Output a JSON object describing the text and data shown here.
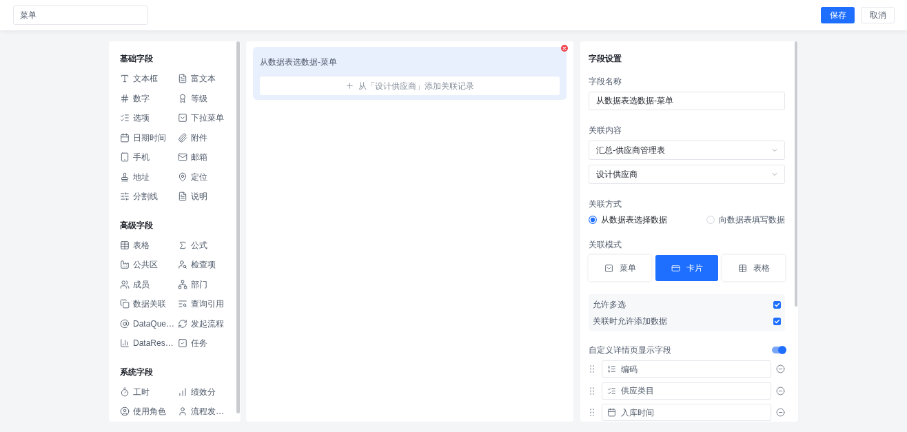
{
  "header": {
    "title_input": {
      "value": "菜单"
    },
    "buttons": [
      {
        "label": "保存",
        "kind": "primary"
      },
      {
        "label": "取消",
        "kind": "secondary"
      }
    ]
  },
  "field_palette": {
    "sections": [
      {
        "title": "基础字段",
        "items": [
          "文本框",
          "富文本",
          "数字",
          "等级",
          "选项",
          "下拉菜单",
          "日期时间",
          "附件",
          "手机",
          "邮箱",
          "地址",
          "定位",
          "分割线",
          "说明"
        ]
      },
      {
        "title": "高级字段",
        "items": [
          "表格",
          "公式",
          "公共区",
          "检查项",
          "成员",
          "部门",
          "数据关联",
          "查询引用",
          "DataQue…",
          "发起流程",
          "DataRes…",
          "任务"
        ]
      },
      {
        "title": "系统字段",
        "items": [
          "工时",
          "绩效分",
          "使用角色",
          "流程发…"
        ]
      }
    ]
  },
  "canvas": {
    "fields": [
      {
        "label": "从数据表选数据-菜单",
        "selected": true,
        "add_button": "从「设计供应商」添加关联记录"
      }
    ]
  },
  "settings": {
    "title": "字段设置",
    "field_name": {
      "label": "字段名称",
      "value": "从数据表选数据-菜单"
    },
    "related_content": {
      "label": "关联内容",
      "selects": [
        {
          "value": "汇总-供应商管理表"
        },
        {
          "value": "设计供应商"
        }
      ]
    },
    "relation_method": {
      "label": "关联方式",
      "options": [
        {
          "label": "从数据表选择数据",
          "selected": true
        },
        {
          "label": "向数据表填写数据",
          "selected": false
        }
      ]
    },
    "relation_mode": {
      "label": "关联模式",
      "options": [
        {
          "label": "菜单",
          "selected": false
        },
        {
          "label": "卡片",
          "selected": true
        },
        {
          "label": "表格",
          "selected": false
        }
      ]
    },
    "options": [
      {
        "label": "允许多选",
        "checked": true
      },
      {
        "label": "关联时允许添加数据",
        "checked": true
      }
    ],
    "detail_fields": {
      "label": "自定义详情页显示字段",
      "on": true,
      "items": [
        "编码",
        "供应类目",
        "入库时间"
      ]
    }
  }
}
